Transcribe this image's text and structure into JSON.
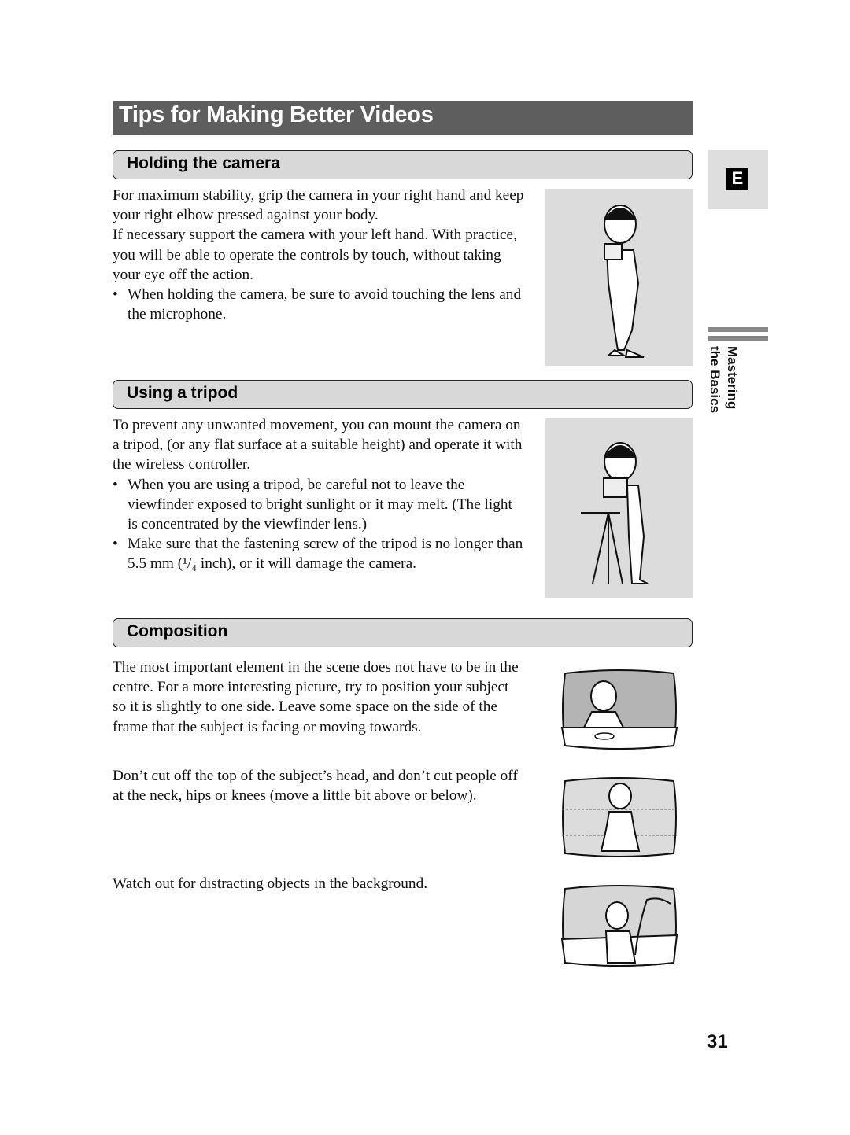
{
  "page": {
    "title": "Tips for Making Better Videos",
    "language_tab": "E",
    "side_label_line1": "Mastering",
    "side_label_line2": "the Basics",
    "page_number": "31"
  },
  "sections": {
    "holding": {
      "heading": "Holding the camera",
      "p1": "For maximum stability, grip the camera in your right hand and keep your right elbow pressed against your body.",
      "p2": "If necessary support the camera with your left hand. With practice, you will be able to operate the controls by touch, without taking your eye off the action.",
      "b1": "When holding the camera, be sure to avoid touching the lens and the microphone."
    },
    "tripod": {
      "heading": "Using a tripod",
      "p1": "To prevent any unwanted movement, you can mount the camera on a tripod, (or any flat surface at a suitable height) and operate it with the wireless controller.",
      "b1": "When you are using a tripod, be careful not to leave the viewfinder exposed to bright sunlight or it may melt. (The light is concentrated by the viewfinder lens.)",
      "b2": "Make sure that the fastening screw of the tripod is no longer than 5.5 mm (¹/₄ inch), or it will damage the camera."
    },
    "composition": {
      "heading": "Composition",
      "p1": "The most important element in the scene does not have to be in the centre. For a more interesting picture, try to position your subject so it is slightly to one side. Leave some space on the side of the frame that the subject is facing or moving towards.",
      "p2": "Don’t cut off the top of the subject’s head, and don’t cut people off at the neck, hips or knees (move a little bit above or below).",
      "p3": "Watch out for distracting objects in the background."
    }
  }
}
